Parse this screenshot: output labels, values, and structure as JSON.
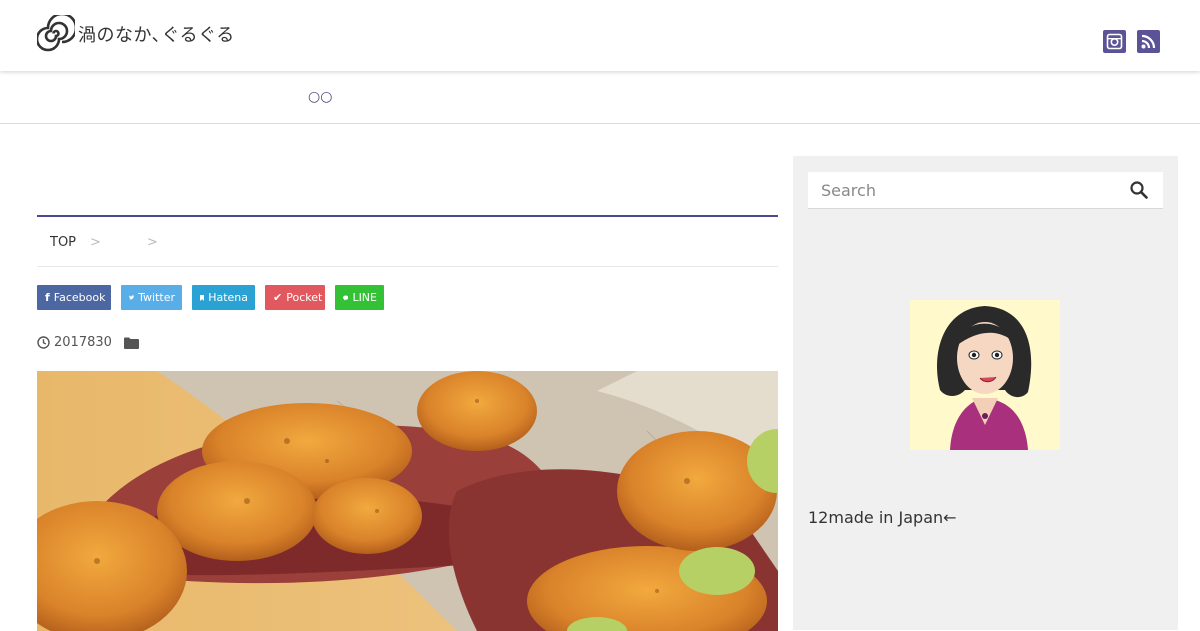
{
  "site": {
    "title": "渦のなか､ぐるぐる"
  },
  "header": {
    "social": [
      {
        "icon": "instagram-icon"
      },
      {
        "icon": "rss-icon"
      }
    ]
  },
  "nav": {
    "items": [
      "○○"
    ]
  },
  "breadcrumb": {
    "top": "TOP",
    "sep": ">"
  },
  "share": {
    "facebook": "Facebook",
    "twitter": "Twitter",
    "hatena": "Hatena",
    "pocket": "Pocket",
    "line": "LINE"
  },
  "post": {
    "date": "2017830"
  },
  "sidebar": {
    "search_placeholder": "Search",
    "profile_text": "12made in Japan←"
  },
  "colors": {
    "accent": "#4b4790",
    "icon_bg": "#5a5496",
    "sidebar_bg": "#f0f0f0",
    "facebook": "#4c67a1",
    "twitter": "#5aaee8",
    "hatena": "#2aa3d4",
    "pocket": "#e1585f",
    "line": "#35c135"
  }
}
